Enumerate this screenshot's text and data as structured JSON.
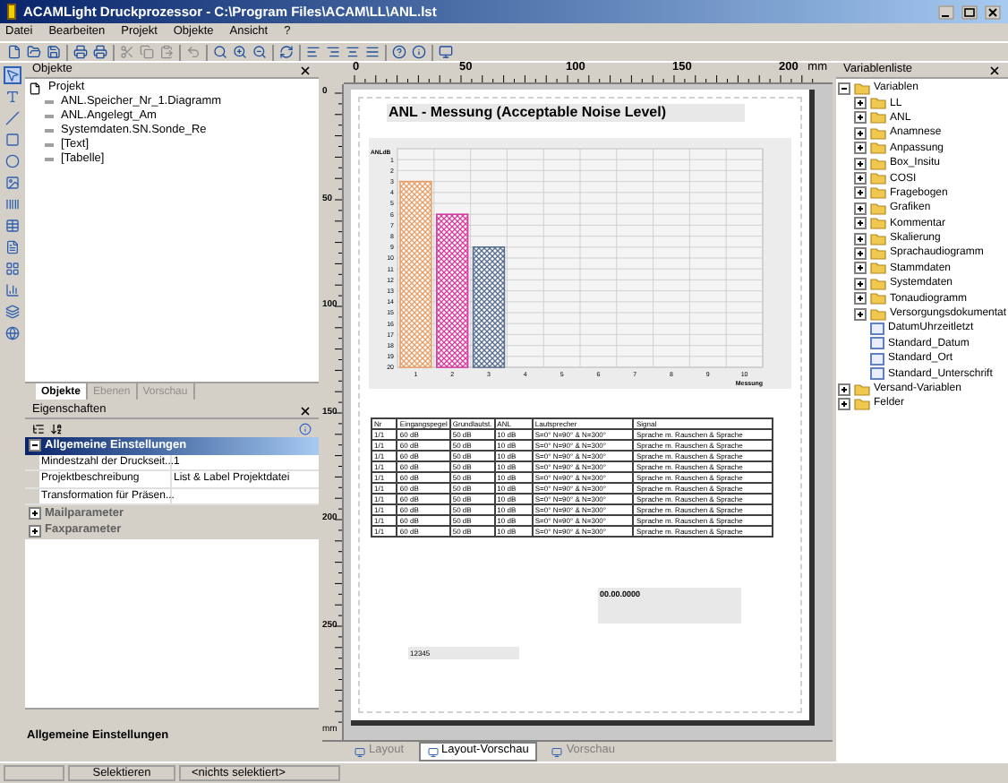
{
  "window": {
    "title": "ACAMLight Druckprozessor - C:\\Program Files\\ACAM\\LL\\ANL.lst"
  },
  "menu": [
    "Datei",
    "Bearbeiten",
    "Projekt",
    "Objekte",
    "Ansicht",
    "?"
  ],
  "objects_panel": {
    "title": "Objekte",
    "tree": [
      {
        "label": "Projekt",
        "children": [
          {
            "label": "ANL.Speicher_Nr_1.Diagramm"
          },
          {
            "label": "ANL.Angelegt_Am"
          },
          {
            "label": "Systemdaten.SN.Sonde_Re"
          },
          {
            "label": "[Text]"
          },
          {
            "label": "[Tabelle]"
          }
        ]
      }
    ],
    "tabs": [
      {
        "label": "Objekte",
        "selected": true
      },
      {
        "label": "Ebenen",
        "selected": false
      },
      {
        "label": "Vorschau",
        "selected": false
      }
    ]
  },
  "properties_panel": {
    "title": "Eigenschaften",
    "groups": [
      {
        "label": "Allgemeine Einstellungen",
        "expanded": true,
        "selected": true,
        "rows": [
          {
            "name": "Mindestzahl der Druckseit...",
            "value": "1"
          },
          {
            "name": "Projektbeschreibung",
            "value": "List & Label Projektdatei"
          },
          {
            "name": "Transformation für Präsen..."
          }
        ]
      },
      {
        "label": "Mailparameter",
        "expanded": false,
        "selected": false
      },
      {
        "label": "Faxparameter",
        "expanded": false,
        "selected": false
      }
    ],
    "description": "Allgemeine Einstellungen"
  },
  "ruler": {
    "top_labels": [
      "0",
      "50",
      "100",
      "150",
      "200"
    ],
    "top_unit": "mm",
    "left_labels": [
      "0",
      "50",
      "100",
      "150",
      "200",
      "250"
    ],
    "left_unit": "mm"
  },
  "page": {
    "title": "ANL - Messung (Acceptable Noise Level)",
    "chart": {
      "y_title": "ANLdB",
      "x_title": "Messung",
      "x_labels": [
        "1",
        "2",
        "3",
        "4",
        "5",
        "6",
        "7",
        "8",
        "9",
        "10"
      ],
      "y_labels": [
        "1",
        "2",
        "3",
        "4",
        "5",
        "6",
        "7",
        "8",
        "9",
        "10",
        "11",
        "12",
        "13",
        "14",
        "15",
        "16",
        "17",
        "18",
        "19",
        "20"
      ]
    },
    "table": {
      "columns": [
        "Nr",
        "Eingangspegel",
        "Grundlautst.",
        "ANL",
        "Lautsprecher",
        "Signal"
      ],
      "rows": [
        [
          "1/1",
          "60 dB",
          "50 dB",
          "10 dB",
          "S=0° N=90° & N=300°",
          "Sprache m. Rauschen & Sprache"
        ],
        [
          "1/1",
          "60 dB",
          "50 dB",
          "10 dB",
          "S=0° N=90° & N=300°",
          "Sprache m. Rauschen & Sprache"
        ],
        [
          "1/1",
          "60 dB",
          "50 dB",
          "10 dB",
          "S=0° N=90° & N=300°",
          "Sprache m. Rauschen & Sprache"
        ],
        [
          "1/1",
          "60 dB",
          "50 dB",
          "10 dB",
          "S=0° N=90° & N=300°",
          "Sprache m. Rauschen & Sprache"
        ],
        [
          "1/1",
          "60 dB",
          "50 dB",
          "10 dB",
          "S=0° N=90° & N=300°",
          "Sprache m. Rauschen & Sprache"
        ],
        [
          "1/1",
          "60 dB",
          "50 dB",
          "10 dB",
          "S=0° N=90° & N=300°",
          "Sprache m. Rauschen & Sprache"
        ],
        [
          "1/1",
          "60 dB",
          "50 dB",
          "10 dB",
          "S=0° N=90° & N=300°",
          "Sprache m. Rauschen & Sprache"
        ],
        [
          "1/1",
          "60 dB",
          "50 dB",
          "10 dB",
          "S=0° N=90° & N=300°",
          "Sprache m. Rauschen & Sprache"
        ],
        [
          "1/1",
          "60 dB",
          "50 dB",
          "10 dB",
          "S=0° N=90° & N=300°",
          "Sprache m. Rauschen & Sprache"
        ],
        [
          "1/1",
          "60 dB",
          "50 dB",
          "10 dB",
          "S=0° N=90° & N=300°",
          "Sprache m. Rauschen & Sprache"
        ]
      ]
    },
    "name_field": "12345",
    "date_field": "00.00.0000"
  },
  "view_tabs": [
    {
      "label": "Layout",
      "selected": false
    },
    {
      "label": "Layout-Vorschau",
      "selected": true
    },
    {
      "label": "Vorschau",
      "selected": false
    }
  ],
  "variables_panel": {
    "title": "Variablenliste",
    "tree": [
      {
        "label": "Variablen",
        "kind": "folder",
        "expanded": true,
        "children": [
          {
            "label": "LL",
            "kind": "folder",
            "expanded": false
          },
          {
            "label": "ANL",
            "kind": "folder",
            "expanded": false
          },
          {
            "label": "Anamnese",
            "kind": "folder",
            "expanded": false
          },
          {
            "label": "Anpassung",
            "kind": "folder",
            "expanded": false
          },
          {
            "label": "Box_Insitu",
            "kind": "folder",
            "expanded": false
          },
          {
            "label": "COSI",
            "kind": "folder",
            "expanded": false
          },
          {
            "label": "Fragebogen",
            "kind": "folder",
            "expanded": false
          },
          {
            "label": "Grafiken",
            "kind": "folder",
            "expanded": false
          },
          {
            "label": "Kommentar",
            "kind": "folder",
            "expanded": false
          },
          {
            "label": "Skalierung",
            "kind": "folder",
            "expanded": false
          },
          {
            "label": "Sprachaudiogramm",
            "kind": "folder",
            "expanded": false
          },
          {
            "label": "Stammdaten",
            "kind": "folder",
            "expanded": false
          },
          {
            "label": "Systemdaten",
            "kind": "folder",
            "expanded": false
          },
          {
            "label": "Tonaudiogramm",
            "kind": "folder",
            "expanded": false
          },
          {
            "label": "Versorgungsdokumentat",
            "kind": "folder",
            "expanded": false
          },
          {
            "label": "DatumUhrzeitletzt",
            "kind": "variable"
          },
          {
            "label": "Standard_Datum",
            "kind": "variable"
          },
          {
            "label": "Standard_Ort",
            "kind": "variable"
          },
          {
            "label": "Standard_Unterschrift",
            "kind": "variable"
          }
        ]
      },
      {
        "label": "Versand-Variablen",
        "kind": "folder",
        "expanded": false
      },
      {
        "label": "Felder",
        "kind": "folder",
        "expanded": false
      }
    ]
  },
  "status_bar": [
    "Selektieren",
    "<nichts selektiert>"
  ]
}
